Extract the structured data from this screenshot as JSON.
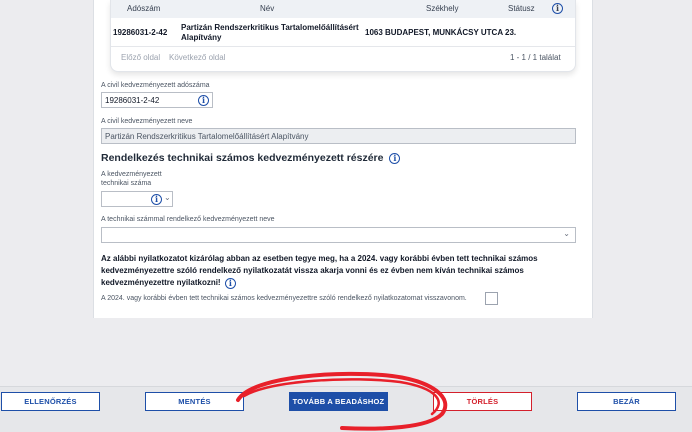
{
  "results": {
    "headers": [
      "Adószám",
      "Név",
      "Székhely",
      "Státusz"
    ],
    "rows": [
      {
        "tax_number": "19286031-2-42",
        "name_line1": "Partizán Rendszerkritikus Tartalomelőállításért",
        "name_line2": "Alapítvány",
        "address": "1063 BUDAPEST, MUNKÁCSY UTCA 23.",
        "status": ""
      }
    ],
    "prev_label": "Előző oldal",
    "next_label": "Következő oldal",
    "count_label": "1 - 1 / 1 találat"
  },
  "form": {
    "tax_label": "A civil kedvezményezett adószáma",
    "tax_value": "19286031-2-42",
    "name_label": "A civil kedvezményezett neve",
    "name_value": "Partizán Rendszerkritikus Tartalomelőállításért Alapítvány",
    "section_title": "Rendelkezés technikai számos kedvezményezett részére",
    "tech_number_label_line1": "A kedvezményezett",
    "tech_number_label_line2": "technikai száma",
    "tech_number_value": "",
    "tech_name_label": "A technikai számmal rendelkező kedvezményezett neve",
    "tech_name_value": "",
    "warning_line1": "Az alábbi nyilatkozatot kizárólag abban az esetben tegye meg, ha a 2024. vagy korábbi évben tett technikai számos",
    "warning_line2": "kedvezményezettre szóló rendelkező nyilatkozatát vissza akarja vonni és ez évben nem kíván technikai számos",
    "warning_line3": "kedvezményezettre nyilatkozni!",
    "revoke_label": "A 2024. vagy korábbi évben tett technikai számos kedvezményezettre szóló rendelkező nyilatkozatomat visszavonom.",
    "revoke_checked": false
  },
  "footer": {
    "check_label": "ELLENŐRZÉS",
    "save_label": "MENTÉS",
    "submit_label": "TOVÁBB A BEADÁSHOZ",
    "delete_label": "TÖRLÉS",
    "close_label": "BEZÁR"
  },
  "icons": {
    "info": "info-icon",
    "chevron": "chevron-down-icon"
  },
  "colors": {
    "primary": "#1e4fa8",
    "danger": "#d4202c",
    "annotation": "#e8202a"
  }
}
